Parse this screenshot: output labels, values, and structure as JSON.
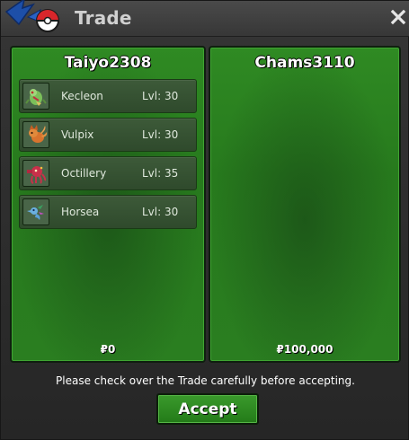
{
  "window": {
    "title": "Trade",
    "close_glyph": "✕"
  },
  "left_panel": {
    "trainer": "Taiyo2308",
    "money": "₽0",
    "pokemon": [
      {
        "name": "Kecleon",
        "level": "Lvl: 30",
        "icon": "kecleon-sprite-icon"
      },
      {
        "name": "Vulpix",
        "level": "Lvl: 30",
        "icon": "vulpix-sprite-icon"
      },
      {
        "name": "Octillery",
        "level": "Lvl: 35",
        "icon": "octillery-sprite-icon"
      },
      {
        "name": "Horsea",
        "level": "Lvl: 30",
        "icon": "horsea-sprite-icon"
      }
    ]
  },
  "right_panel": {
    "trainer": "Chams3110",
    "money": "₽100,000",
    "pokemon": []
  },
  "footer": {
    "notice": "Please check over the Trade carefully before accepting.",
    "accept_label": "Accept"
  },
  "colors": {
    "panel_green": "#2a7e20",
    "button_green": "#2f8a23",
    "titlebar": "#424242",
    "text_light": "#ffffff"
  }
}
